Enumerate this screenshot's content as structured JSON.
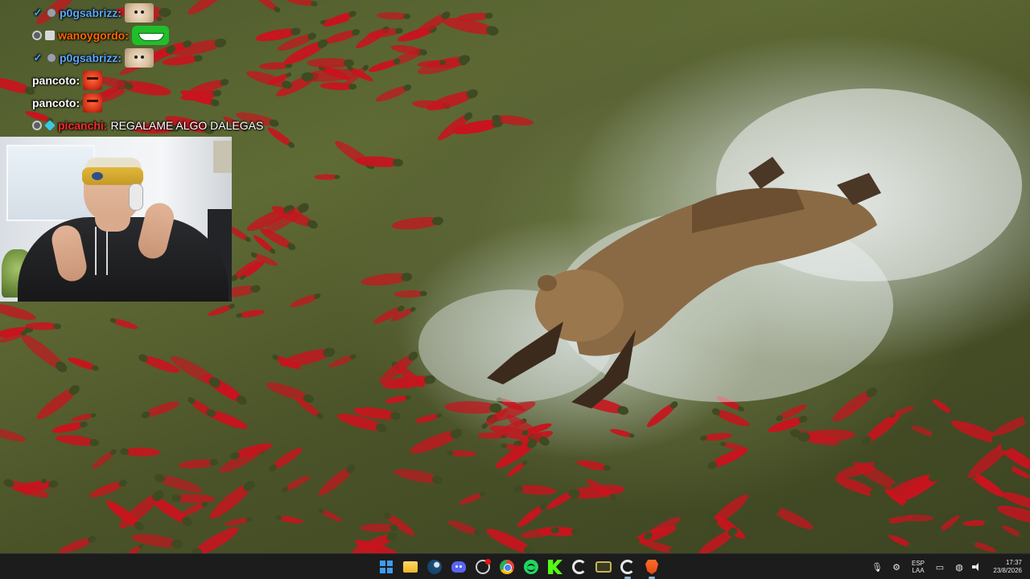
{
  "chat": {
    "messages": [
      {
        "user": "p0gsabrizz:",
        "user_color": "#5ba8ff",
        "badges": [
          "verified-check",
          "grey-circle"
        ],
        "text": "",
        "emote": "cat-emote"
      },
      {
        "user": "wanoygordo:",
        "user_color": "#ff6a00",
        "badges": [
          "moderator",
          "shield"
        ],
        "text": "",
        "emote": "grin-emote"
      },
      {
        "user": "p0gsabrizz:",
        "user_color": "#5ba8ff",
        "badges": [
          "verified-check",
          "grey-circle"
        ],
        "text": "",
        "emote": "cat-emote"
      },
      {
        "user": "pancoto:",
        "user_color": "#ffffff",
        "badges": [],
        "text": "",
        "emote": "face-emote"
      },
      {
        "user": "pancoto:",
        "user_color": "#ffffff",
        "badges": [],
        "text": "",
        "emote": "face-emote"
      },
      {
        "user": "picanchi:",
        "user_color": "#ff2a2a",
        "badges": [
          "moderator",
          "cube"
        ],
        "text": "REGALAME ALGO DALEGAS",
        "emote": ""
      }
    ]
  },
  "webcam": {
    "label": "streamer-webcam-feed"
  },
  "wallpaper": {
    "subject": "bear-chasing-salmon-in-river"
  },
  "taskbar": {
    "apps": [
      {
        "name": "start-menu",
        "icon": "windows-logo-icon",
        "active": false
      },
      {
        "name": "file-explorer",
        "icon": "folder-icon",
        "active": false
      },
      {
        "name": "steam",
        "icon": "steam-icon",
        "active": false
      },
      {
        "name": "discord",
        "icon": "discord-icon",
        "active": false
      },
      {
        "name": "obs",
        "icon": "record-circle-icon",
        "active": false
      },
      {
        "name": "chrome",
        "icon": "chrome-icon",
        "active": false
      },
      {
        "name": "spotify",
        "icon": "spotify-icon",
        "active": false
      },
      {
        "name": "kick",
        "icon": "kick-icon",
        "active": false
      },
      {
        "name": "ccleaner",
        "icon": "c-logo-icon",
        "active": false
      },
      {
        "name": "game-launcher",
        "icon": "gamepad-icon",
        "active": false
      },
      {
        "name": "ccleaner-2",
        "icon": "c-logo-icon",
        "active": true
      },
      {
        "name": "brave",
        "icon": "brave-lion-icon",
        "active": true
      }
    ],
    "tray": {
      "lang_line1": "ESP",
      "lang_line2": "LAA",
      "time": "17:37",
      "date": "23/8/2026"
    }
  },
  "colors": {
    "taskbar_bg": "#1c1c1c",
    "start_blue": "#3c9cf0",
    "salmon_red": "#c8141e"
  }
}
